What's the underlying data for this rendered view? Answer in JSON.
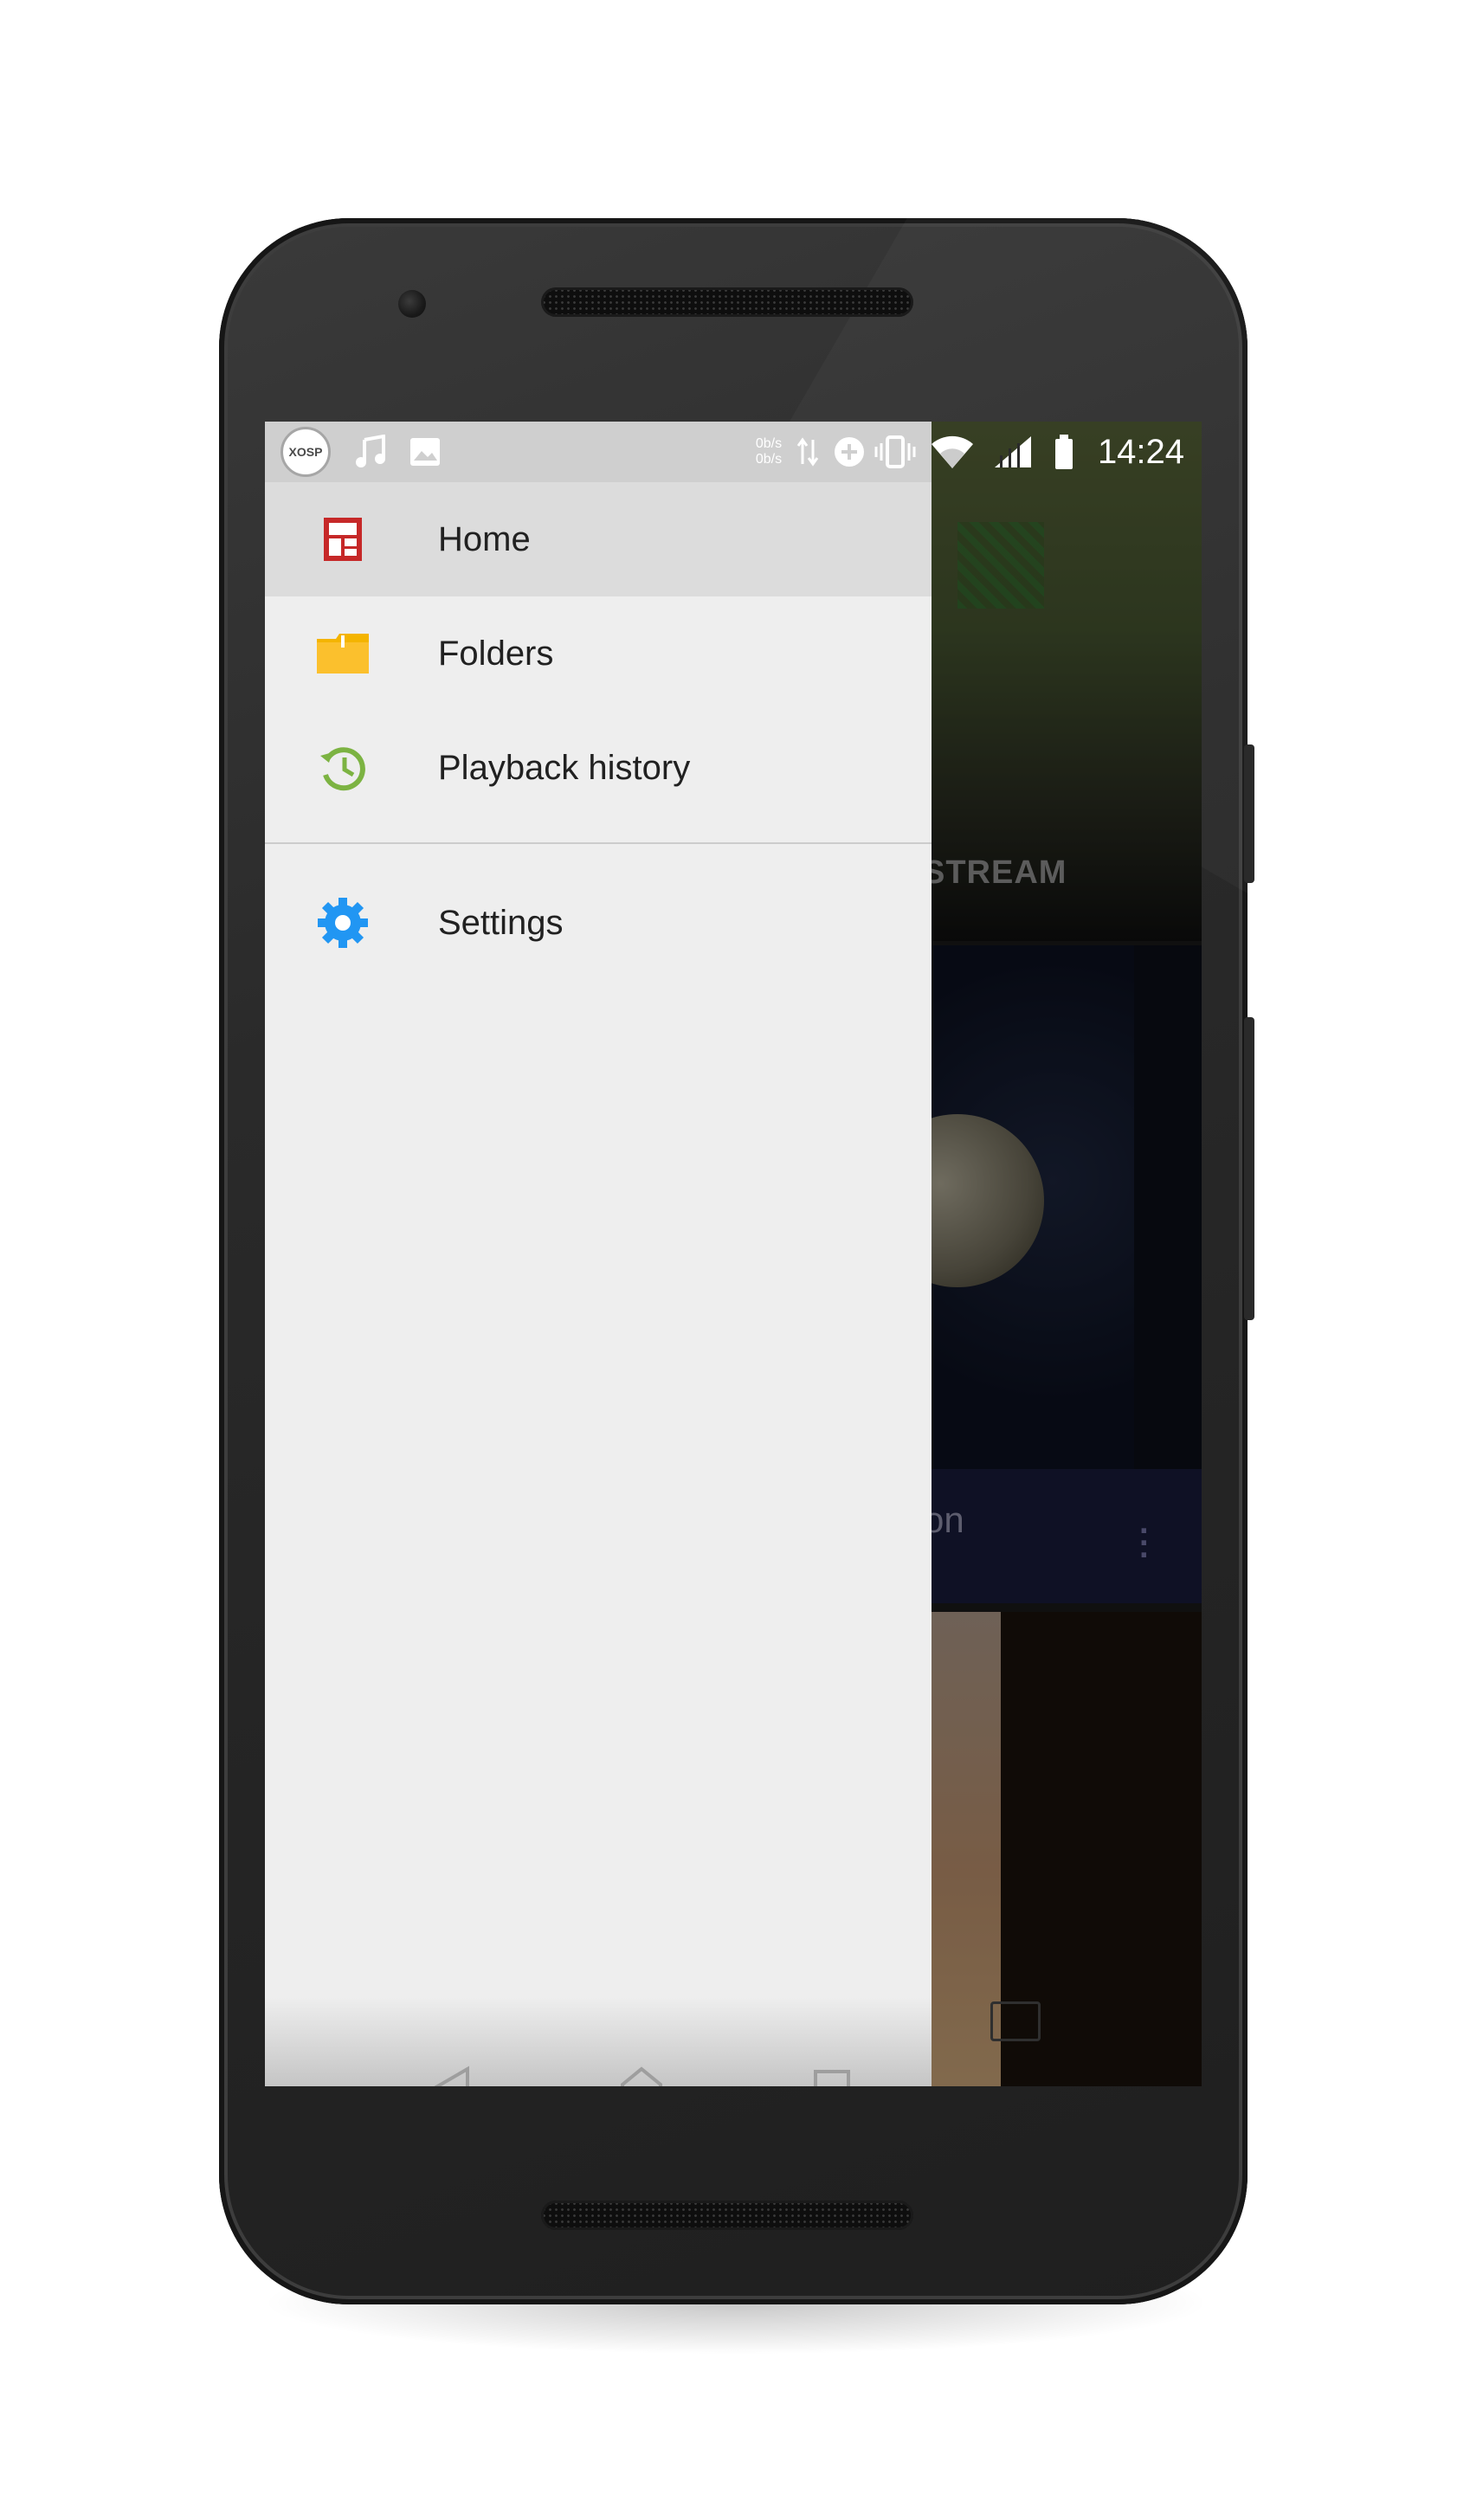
{
  "status_bar": {
    "badge": "XOSP",
    "net_speed_up": "0b/s",
    "net_speed_down": "0b/s",
    "time": "14:24",
    "icons": [
      "music-note-icon",
      "image-icon",
      "data-transfer-icon",
      "data-saver-icon",
      "vibrate-icon",
      "wifi-icon",
      "cellular-signal-icon",
      "battery-icon"
    ]
  },
  "drawer": {
    "items": [
      {
        "label": "Home",
        "icon": "home-grid-icon",
        "active": true,
        "color": "#c62828"
      },
      {
        "label": "Folders",
        "icon": "folder-icon",
        "active": false,
        "color": "#f4b400"
      },
      {
        "label": "Playback history",
        "icon": "history-icon",
        "active": false,
        "color": "#7cb342"
      }
    ],
    "secondary_items": [
      {
        "label": "Settings",
        "icon": "gear-icon",
        "active": false,
        "color": "#2196f3"
      }
    ]
  },
  "background_app": {
    "tab_text": "STREAM",
    "card_title_fragment": "tion"
  },
  "nav_bar": {
    "buttons": [
      "back-icon",
      "home-icon",
      "recents-icon"
    ]
  }
}
